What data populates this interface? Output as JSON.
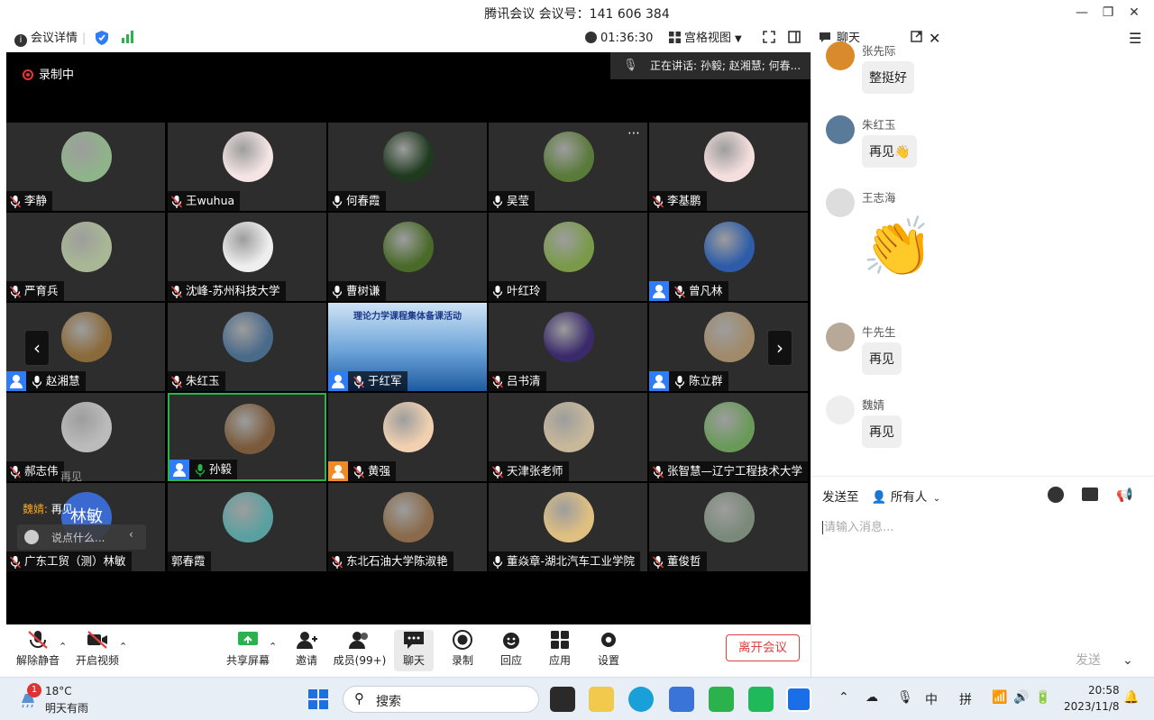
{
  "window": {
    "title": "腾讯会议 会议号：141 606 384"
  },
  "toolbar": {
    "meeting_details": "会议详情",
    "timer": "01:36:30",
    "view_mode": "宫格视图",
    "chat_tab": "聊天"
  },
  "video": {
    "recording": "录制中",
    "speaking": "正在讲话:  孙毅; 赵湘慧; 何春..."
  },
  "participants": [
    {
      "name": "李静",
      "mic": "muted",
      "host": false
    },
    {
      "name": "王wuhua",
      "mic": "muted",
      "host": false
    },
    {
      "name": "何春霞",
      "mic": "on",
      "host": false
    },
    {
      "name": "吴莹",
      "mic": "on",
      "host": false
    },
    {
      "name": "李基鹏",
      "mic": "muted",
      "host": false
    },
    {
      "name": "严育兵",
      "mic": "muted",
      "host": false
    },
    {
      "name": "沈峰-苏州科技大学",
      "mic": "muted",
      "host": false
    },
    {
      "name": "曹树谦",
      "mic": "on",
      "host": false
    },
    {
      "name": "叶红玲",
      "mic": "on",
      "host": false
    },
    {
      "name": "曾凡林",
      "mic": "muted",
      "host": true
    },
    {
      "name": "赵湘慧",
      "mic": "on",
      "host": true
    },
    {
      "name": "朱红玉",
      "mic": "muted",
      "host": false
    },
    {
      "name": "于红军",
      "mic": "muted",
      "host": true
    },
    {
      "name": "吕书清",
      "mic": "muted",
      "host": false
    },
    {
      "name": "陈立群",
      "mic": "on",
      "host": true
    },
    {
      "name": "郝志伟",
      "mic": "muted",
      "host": false
    },
    {
      "name": "孙毅",
      "mic": "speaking",
      "host": true
    },
    {
      "name": "黄强",
      "mic": "muted",
      "host": true
    },
    {
      "name": "天津张老师",
      "mic": "muted",
      "host": false
    },
    {
      "name": "张智慧—辽宁工程技术大学",
      "mic": "muted",
      "host": false
    },
    {
      "name": "广东工贸（测）林敏",
      "mic": "muted",
      "host": false
    },
    {
      "name": "郭春霞",
      "mic": "none",
      "host": false
    },
    {
      "name": "东北石油大学陈淑艳",
      "mic": "muted",
      "host": false
    },
    {
      "name": "董焱章-湖北汽车工业学院",
      "mic": "on",
      "host": false
    },
    {
      "name": "董俊哲",
      "mic": "muted",
      "host": false
    }
  ],
  "tile_extras": {
    "linmin_initials": "林敏",
    "presentation_title": "理论力学课程集体备课活动"
  },
  "chat_overlay": {
    "faded_line": "再见",
    "sender": "魏婧:",
    "message": "再见",
    "input_placeholder": "说点什么..."
  },
  "chat": {
    "messages": [
      {
        "sender": "张先际",
        "text": "整挺好"
      },
      {
        "sender": "朱红玉",
        "text": "再见👋"
      },
      {
        "sender": "王志海",
        "text": "👏"
      },
      {
        "sender": "牛先生",
        "text": "再见"
      },
      {
        "sender": "魏婧",
        "text": "再见"
      }
    ],
    "send_to_label": "发送至",
    "recipient": "所有人",
    "input_placeholder": "请输入消息...",
    "send_button": "发送"
  },
  "meetbar": {
    "unmute": "解除静音",
    "start_video": "开启视频",
    "share_screen": "共享屏幕",
    "invite": "邀请",
    "members": "成员(99+)",
    "chat": "聊天",
    "record": "录制",
    "replay": "回应",
    "apps": "应用",
    "settings": "设置",
    "leave": "离开会议"
  },
  "taskbar": {
    "weather_badge": "1",
    "temp": "18°C",
    "forecast": "明天有雨",
    "search": "搜索",
    "ime_lang": "中",
    "ime_mode": "拼",
    "time": "20:58",
    "date": "2023/11/8"
  },
  "colors": {
    "accent": "#2f7cf6",
    "speaking_border": "#2bb24c",
    "leave": "#e04040",
    "tile_bg": "#2d2d2d"
  }
}
